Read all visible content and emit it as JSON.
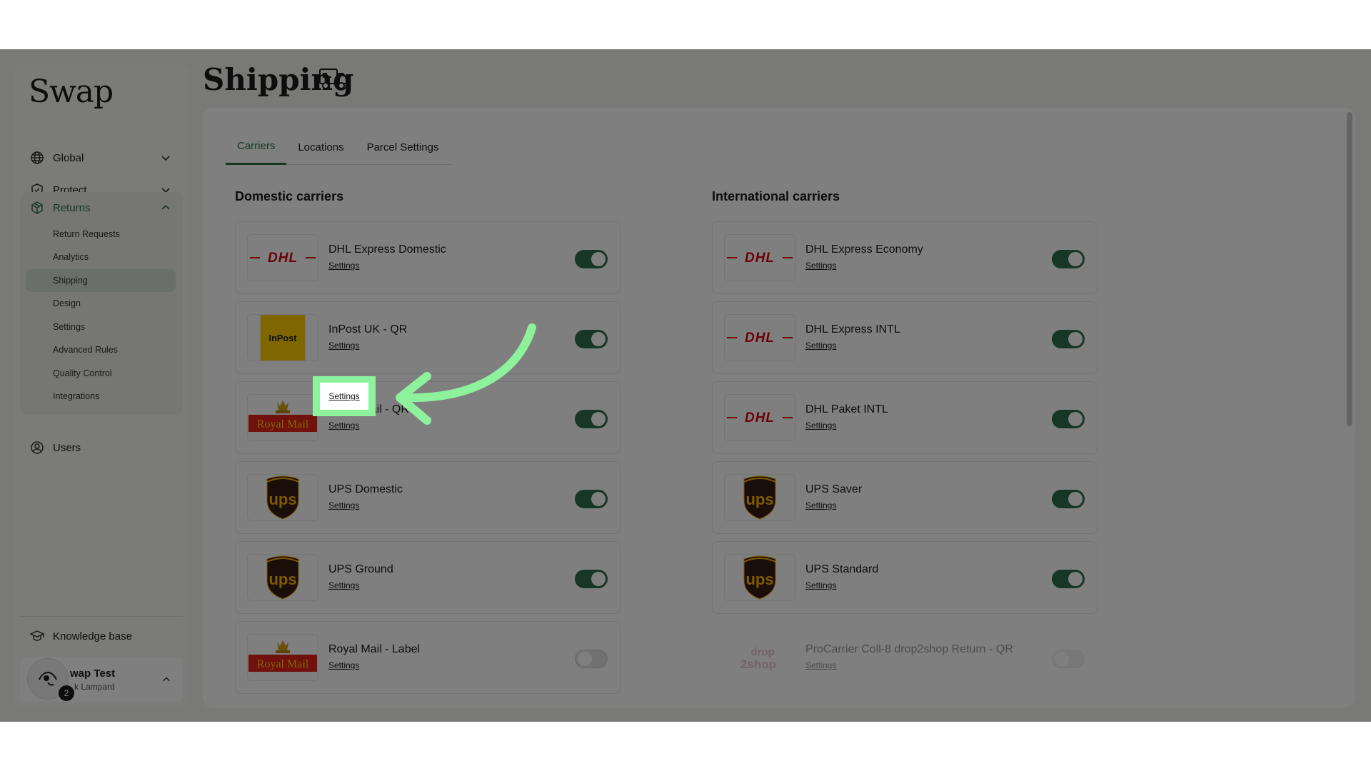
{
  "app": {
    "logo": "Swap"
  },
  "sidebar": {
    "nav": [
      {
        "label": "Global",
        "icon": "globe-icon"
      },
      {
        "label": "Protect",
        "icon": "shield-icon"
      },
      {
        "label": "Returns",
        "icon": "package-icon"
      },
      {
        "label": "Users",
        "icon": "user-circle-icon"
      }
    ],
    "returns_sub": [
      {
        "label": "Return Requests"
      },
      {
        "label": "Analytics"
      },
      {
        "label": "Shipping",
        "active": true
      },
      {
        "label": "Design"
      },
      {
        "label": "Settings"
      },
      {
        "label": "Advanced Rules"
      },
      {
        "label": "Quality Control"
      },
      {
        "label": "Integrations"
      }
    ],
    "knowledge_base": "Knowledge base",
    "profile": {
      "name": "wap Test",
      "sub": "k Lampard",
      "notifications": "2"
    }
  },
  "page": {
    "title": "Shipping",
    "title_icon": "truck-icon"
  },
  "tabs": [
    {
      "label": "Carriers",
      "active": true
    },
    {
      "label": "Locations"
    },
    {
      "label": "Parcel Settings"
    }
  ],
  "domestic": {
    "title": "Domestic carriers",
    "carriers": [
      {
        "name": "DHL Express Domestic",
        "settings": "Settings",
        "logo": "dhl",
        "enabled": true
      },
      {
        "name": "InPost UK - QR",
        "settings": "Settings",
        "logo": "inpost",
        "enabled": true
      },
      {
        "name": "Royal Mail - QR",
        "settings": "Settings",
        "logo": "royalmail",
        "enabled": true
      },
      {
        "name": "UPS Domestic",
        "settings": "Settings",
        "logo": "ups",
        "enabled": true
      },
      {
        "name": "UPS Ground",
        "settings": "Settings",
        "logo": "ups",
        "enabled": true
      },
      {
        "name": "Royal Mail - Label",
        "settings": "Settings",
        "logo": "royalmail",
        "enabled": false
      }
    ]
  },
  "international": {
    "title": "International carriers",
    "carriers": [
      {
        "name": "DHL Express Economy",
        "settings": "Settings",
        "logo": "dhl",
        "enabled": true
      },
      {
        "name": "DHL Express INTL",
        "settings": "Settings",
        "logo": "dhl",
        "enabled": true
      },
      {
        "name": "DHL Paket INTL",
        "settings": "Settings",
        "logo": "dhl",
        "enabled": true
      },
      {
        "name": "UPS Saver",
        "settings": "Settings",
        "logo": "ups",
        "enabled": true
      },
      {
        "name": "UPS Standard",
        "settings": "Settings",
        "logo": "ups",
        "enabled": true
      },
      {
        "name": "ProCarrier Coll-8 drop2shop Return - QR",
        "settings": "Settings",
        "logo": "drop2shop",
        "enabled": false,
        "faded": true
      }
    ]
  },
  "logos": {
    "dhl": "DHL",
    "inpost": "InPost",
    "royalmail": "Royal Mail",
    "ups": "ups",
    "drop2shop_top": "drop",
    "drop2shop_bottom": "2shop"
  },
  "highlight": {
    "label": "Settings"
  },
  "colors": {
    "accent": "#2f6d4a",
    "highlight": "#8ef29c",
    "dhl_red": "#d40511",
    "dhl_yellow": "#ffcc00",
    "ups_brown": "#351c15",
    "ups_gold": "#ffb500",
    "royal_mail_red": "#e2231a",
    "inpost_yellow": "#ffcd00"
  }
}
